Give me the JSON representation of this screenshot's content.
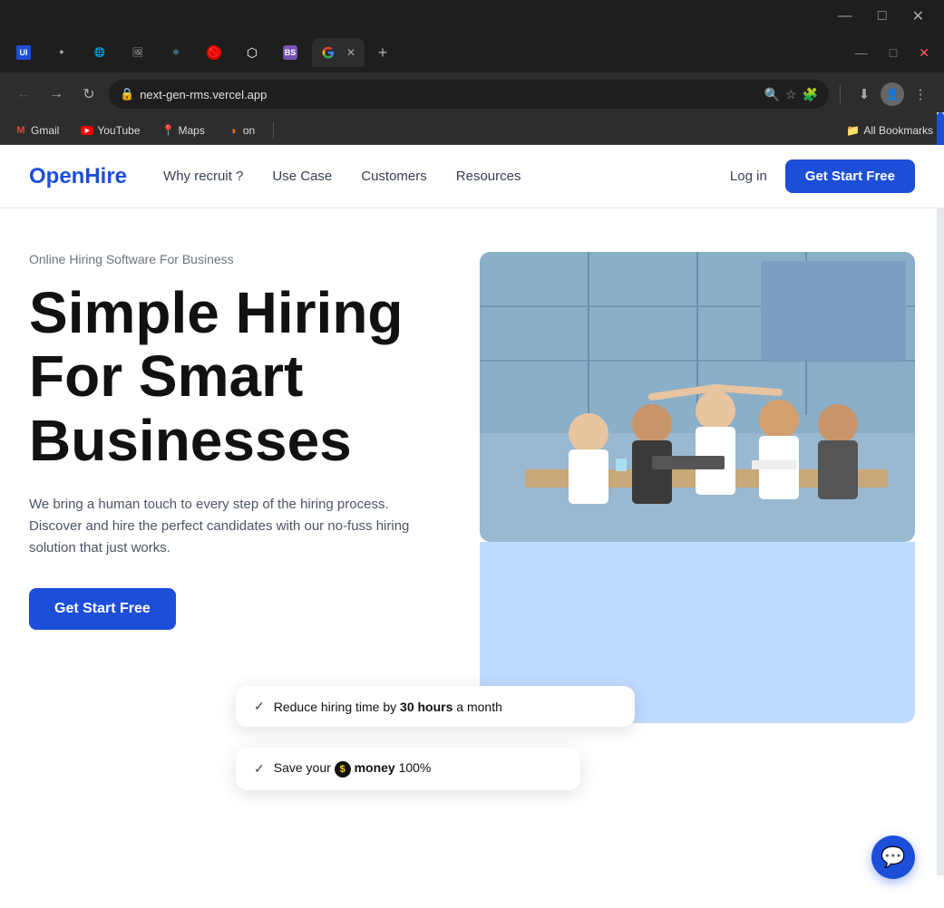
{
  "browser": {
    "tabs": [
      {
        "id": "t1",
        "favicon": "🟦",
        "label": "UI",
        "active": false
      },
      {
        "id": "t2",
        "favicon": "✦",
        "label": "",
        "active": false
      },
      {
        "id": "t3",
        "favicon": "🌐",
        "label": "",
        "active": false
      },
      {
        "id": "t4",
        "favicon": "🖼",
        "label": "",
        "active": false
      },
      {
        "id": "t5",
        "favicon": "⚛",
        "label": "",
        "active": false
      },
      {
        "id": "t6",
        "favicon": "🚫",
        "label": "",
        "active": false
      },
      {
        "id": "t7",
        "favicon": "⬡",
        "label": "",
        "active": false
      },
      {
        "id": "t8",
        "favicon": "BS",
        "label": "BS",
        "active": false
      },
      {
        "id": "t9",
        "favicon": "G",
        "label": "",
        "active": true,
        "hasClose": true
      }
    ],
    "address": "next-gen-rms.vercel.app",
    "bookmarks": [
      {
        "label": "Gmail",
        "favicon": "M",
        "color": "#EA4335"
      },
      {
        "label": "YouTube",
        "favicon": "▶",
        "color": "#FF0000"
      },
      {
        "label": "Maps",
        "favicon": "📍",
        "color": "#34A853"
      },
      {
        "label": "on",
        "favicon": "○",
        "color": "#f97316"
      }
    ],
    "all_bookmarks": "All Bookmarks",
    "window_controls": {
      "minimize": "—",
      "maximize": "□",
      "close": "✕"
    }
  },
  "navbar": {
    "logo_open": "Open",
    "logo_hire": "Hire",
    "links": [
      {
        "label": "Why recruit ?"
      },
      {
        "label": "Use Case"
      },
      {
        "label": "Customers"
      },
      {
        "label": "Resources"
      }
    ],
    "login": "Log in",
    "cta": "Get Start Free"
  },
  "hero": {
    "subtitle": "Online Hiring Software For Business",
    "title": "Simple Hiring For Smart Businesses",
    "description": "We bring a human touch to every step of the hiring process. Discover and hire the perfect candidates with our no-fuss hiring solution that just works.",
    "cta": "Get Start Free"
  },
  "tooltips": [
    {
      "check": "✓",
      "text_before": "Reduce hiring time by ",
      "bold": "30 hours",
      "text_after": " a month"
    },
    {
      "check": "✓",
      "text_before": "Save your ",
      "money_icon": "$",
      "bold": "money",
      "text_after": " 100%"
    }
  ],
  "scrollbar": {
    "accent": "#1d4ed8"
  }
}
